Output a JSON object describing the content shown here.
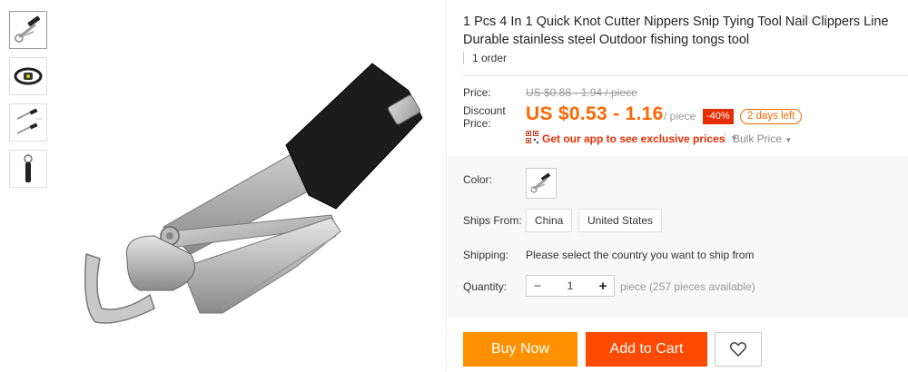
{
  "product": {
    "title": "1 Pcs 4 In 1 Quick Knot Cutter Nippers Snip Tying Tool Nail Clippers Line Durable stainless steel Outdoor fishing tongs tool",
    "orders": "1 order"
  },
  "price": {
    "price_label": "Price:",
    "original": "US $0.88 - 1.94 / piece",
    "discount_label": "Discount Price:",
    "current": "US $0.53 - 1.16",
    "unit": "/ piece",
    "discount_badge": "-40%",
    "time_left": "2 days left",
    "app_promo": "Get our app to see exclusive prices",
    "bulk_price": "Bulk Price"
  },
  "options": {
    "color_label": "Color:",
    "ships_from_label": "Ships From:",
    "ships_from_options": [
      "China",
      "United States"
    ],
    "shipping_label": "Shipping:",
    "shipping_text": "Please select the country you want to ship from",
    "quantity_label": "Quantity:",
    "quantity_value": "1",
    "quantity_note": "piece (257 pieces available)"
  },
  "actions": {
    "buy_now": "Buy Now",
    "add_to_cart": "Add to Cart"
  },
  "icons": {
    "qr": "qr-code-icon",
    "wishlist": "heart-icon",
    "minus": "minus-icon",
    "plus": "plus-icon",
    "dropdown": "chevron-down-icon"
  },
  "colors": {
    "price": "#ff6600",
    "badge": "#e62e04",
    "buy_now": "#ff9100",
    "add_to_cart": "#ff4a00"
  }
}
